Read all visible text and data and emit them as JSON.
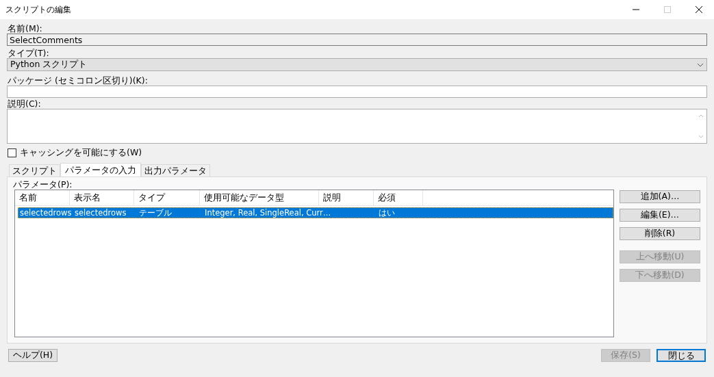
{
  "window": {
    "title": "スクリプトの編集"
  },
  "name_field": {
    "label": "名前(M):",
    "value": "SelectComments"
  },
  "type_field": {
    "label": "タイプ(T):",
    "value": "Python スクリプト"
  },
  "package_field": {
    "label": "パッケージ (セミコロン区切り)(K):"
  },
  "description_field": {
    "label": "説明(C):"
  },
  "caching": {
    "label": "キャッシングを可能にする(W)",
    "checked": false
  },
  "tabs": [
    {
      "label": "スクリプト",
      "selected": false
    },
    {
      "label": "パラメータの入力",
      "selected": true
    },
    {
      "label": "出力パラメータ",
      "selected": false
    }
  ],
  "parameters": {
    "label": "パラメータ(P):",
    "columns": [
      "名前",
      "表示名",
      "タイプ",
      "使用可能なデータ型",
      "説明",
      "必須"
    ],
    "rows": [
      {
        "cells": [
          "selectedrows",
          "selectedrows",
          "テーブル",
          "Integer, Real, SingleReal, Curr…",
          "",
          "はい"
        ],
        "selected": true
      }
    ]
  },
  "side_buttons": [
    {
      "label": "追加(A)…",
      "disabled": false
    },
    {
      "label": "編集(E)…",
      "disabled": false
    },
    {
      "label": "削除(R)",
      "disabled": false
    },
    {
      "label": "上へ移動(U)",
      "disabled": true
    },
    {
      "label": "下へ移動(D)",
      "disabled": true
    }
  ],
  "help_button": "ヘルプ(H)",
  "footer_buttons": [
    {
      "label": "保存(S)",
      "disabled": true,
      "default": false
    },
    {
      "label": "閉じる",
      "disabled": false,
      "default": true
    }
  ]
}
